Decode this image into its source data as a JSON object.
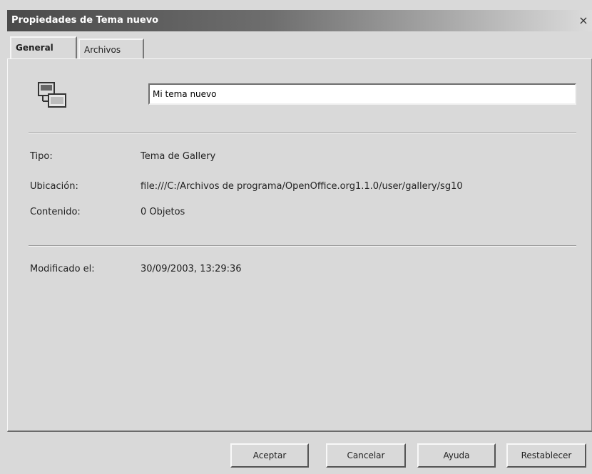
{
  "window": {
    "title": "Propiedades de Tema nuevo",
    "close_symbol": "×"
  },
  "tabs": [
    {
      "label": "General",
      "active": true
    },
    {
      "label": "Archivos",
      "active": false
    }
  ],
  "general": {
    "icon": "gallery-theme-icon",
    "name_value": "Mi tema nuevo",
    "rows": [
      {
        "label": "Tipo:",
        "value": "Tema de Gallery"
      },
      {
        "label": "Ubicación:",
        "value": "file:///C:/Archivos de programa/OpenOffice.org1.1.0/user/gallery/sg10"
      },
      {
        "label": "Contenido:",
        "value": "0 Objetos"
      },
      {
        "label": "Modificado el:",
        "value": "30/09/2003, 13:29:36"
      }
    ]
  },
  "buttons": {
    "ok": "Aceptar",
    "cancel": "Cancelar",
    "help": "Ayuda",
    "reset": "Restablecer"
  }
}
